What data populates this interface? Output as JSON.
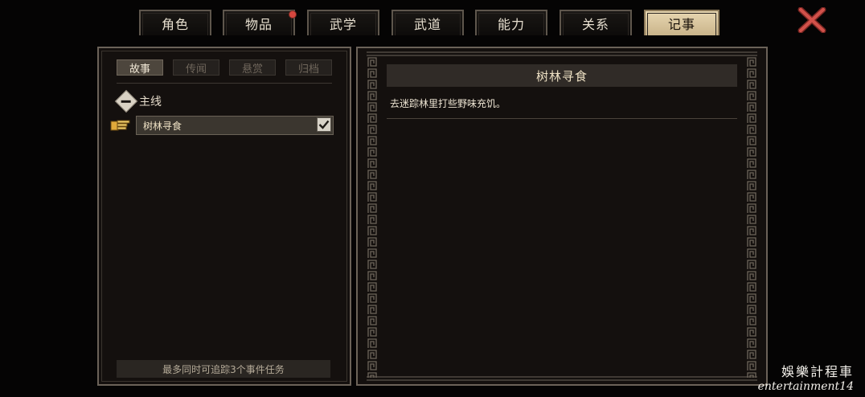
{
  "tabs": [
    {
      "label": "角色",
      "active": false,
      "badge": false
    },
    {
      "label": "物品",
      "active": false,
      "badge": true
    },
    {
      "label": "武学",
      "active": false,
      "badge": false
    },
    {
      "label": "武道",
      "active": false,
      "badge": false
    },
    {
      "label": "能力",
      "active": false,
      "badge": false
    },
    {
      "label": "关系",
      "active": false,
      "badge": false
    },
    {
      "label": "记事",
      "active": true,
      "badge": false
    }
  ],
  "close_icon": "close-x-icon",
  "journal": {
    "subtabs": [
      {
        "label": "故事",
        "active": true
      },
      {
        "label": "传闻",
        "active": false
      },
      {
        "label": "悬赏",
        "active": false
      },
      {
        "label": "归档",
        "active": false
      }
    ],
    "group_label": "主线",
    "quest": {
      "name": "树林寻食",
      "tracked": true
    },
    "footer_note": "最多同时可追踪3个事件任务"
  },
  "detail": {
    "title": "树林寻食",
    "description": "去迷踪林里打些野味充饥。"
  },
  "watermark": {
    "line1": "娛樂計程車",
    "line2": "entertainment14"
  },
  "colors": {
    "accent_active_tab": "#d9c79f",
    "badge": "#d5473f",
    "close": "#c8443d",
    "panel_bg": "#14100e"
  }
}
